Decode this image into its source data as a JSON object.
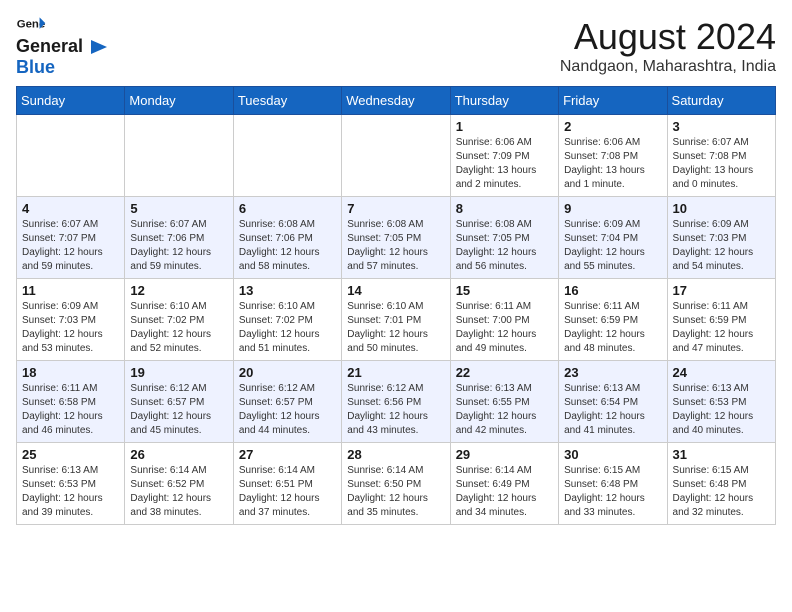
{
  "header": {
    "logo_general": "General",
    "logo_blue": "Blue",
    "month_title": "August 2024",
    "location": "Nandgaon, Maharashtra, India"
  },
  "days_of_week": [
    "Sunday",
    "Monday",
    "Tuesday",
    "Wednesday",
    "Thursday",
    "Friday",
    "Saturday"
  ],
  "weeks": [
    [
      {
        "day": "",
        "info": ""
      },
      {
        "day": "",
        "info": ""
      },
      {
        "day": "",
        "info": ""
      },
      {
        "day": "",
        "info": ""
      },
      {
        "day": "1",
        "info": "Sunrise: 6:06 AM\nSunset: 7:09 PM\nDaylight: 13 hours\nand 2 minutes."
      },
      {
        "day": "2",
        "info": "Sunrise: 6:06 AM\nSunset: 7:08 PM\nDaylight: 13 hours\nand 1 minute."
      },
      {
        "day": "3",
        "info": "Sunrise: 6:07 AM\nSunset: 7:08 PM\nDaylight: 13 hours\nand 0 minutes."
      }
    ],
    [
      {
        "day": "4",
        "info": "Sunrise: 6:07 AM\nSunset: 7:07 PM\nDaylight: 12 hours\nand 59 minutes."
      },
      {
        "day": "5",
        "info": "Sunrise: 6:07 AM\nSunset: 7:06 PM\nDaylight: 12 hours\nand 59 minutes."
      },
      {
        "day": "6",
        "info": "Sunrise: 6:08 AM\nSunset: 7:06 PM\nDaylight: 12 hours\nand 58 minutes."
      },
      {
        "day": "7",
        "info": "Sunrise: 6:08 AM\nSunset: 7:05 PM\nDaylight: 12 hours\nand 57 minutes."
      },
      {
        "day": "8",
        "info": "Sunrise: 6:08 AM\nSunset: 7:05 PM\nDaylight: 12 hours\nand 56 minutes."
      },
      {
        "day": "9",
        "info": "Sunrise: 6:09 AM\nSunset: 7:04 PM\nDaylight: 12 hours\nand 55 minutes."
      },
      {
        "day": "10",
        "info": "Sunrise: 6:09 AM\nSunset: 7:03 PM\nDaylight: 12 hours\nand 54 minutes."
      }
    ],
    [
      {
        "day": "11",
        "info": "Sunrise: 6:09 AM\nSunset: 7:03 PM\nDaylight: 12 hours\nand 53 minutes."
      },
      {
        "day": "12",
        "info": "Sunrise: 6:10 AM\nSunset: 7:02 PM\nDaylight: 12 hours\nand 52 minutes."
      },
      {
        "day": "13",
        "info": "Sunrise: 6:10 AM\nSunset: 7:02 PM\nDaylight: 12 hours\nand 51 minutes."
      },
      {
        "day": "14",
        "info": "Sunrise: 6:10 AM\nSunset: 7:01 PM\nDaylight: 12 hours\nand 50 minutes."
      },
      {
        "day": "15",
        "info": "Sunrise: 6:11 AM\nSunset: 7:00 PM\nDaylight: 12 hours\nand 49 minutes."
      },
      {
        "day": "16",
        "info": "Sunrise: 6:11 AM\nSunset: 6:59 PM\nDaylight: 12 hours\nand 48 minutes."
      },
      {
        "day": "17",
        "info": "Sunrise: 6:11 AM\nSunset: 6:59 PM\nDaylight: 12 hours\nand 47 minutes."
      }
    ],
    [
      {
        "day": "18",
        "info": "Sunrise: 6:11 AM\nSunset: 6:58 PM\nDaylight: 12 hours\nand 46 minutes."
      },
      {
        "day": "19",
        "info": "Sunrise: 6:12 AM\nSunset: 6:57 PM\nDaylight: 12 hours\nand 45 minutes."
      },
      {
        "day": "20",
        "info": "Sunrise: 6:12 AM\nSunset: 6:57 PM\nDaylight: 12 hours\nand 44 minutes."
      },
      {
        "day": "21",
        "info": "Sunrise: 6:12 AM\nSunset: 6:56 PM\nDaylight: 12 hours\nand 43 minutes."
      },
      {
        "day": "22",
        "info": "Sunrise: 6:13 AM\nSunset: 6:55 PM\nDaylight: 12 hours\nand 42 minutes."
      },
      {
        "day": "23",
        "info": "Sunrise: 6:13 AM\nSunset: 6:54 PM\nDaylight: 12 hours\nand 41 minutes."
      },
      {
        "day": "24",
        "info": "Sunrise: 6:13 AM\nSunset: 6:53 PM\nDaylight: 12 hours\nand 40 minutes."
      }
    ],
    [
      {
        "day": "25",
        "info": "Sunrise: 6:13 AM\nSunset: 6:53 PM\nDaylight: 12 hours\nand 39 minutes."
      },
      {
        "day": "26",
        "info": "Sunrise: 6:14 AM\nSunset: 6:52 PM\nDaylight: 12 hours\nand 38 minutes."
      },
      {
        "day": "27",
        "info": "Sunrise: 6:14 AM\nSunset: 6:51 PM\nDaylight: 12 hours\nand 37 minutes."
      },
      {
        "day": "28",
        "info": "Sunrise: 6:14 AM\nSunset: 6:50 PM\nDaylight: 12 hours\nand 35 minutes."
      },
      {
        "day": "29",
        "info": "Sunrise: 6:14 AM\nSunset: 6:49 PM\nDaylight: 12 hours\nand 34 minutes."
      },
      {
        "day": "30",
        "info": "Sunrise: 6:15 AM\nSunset: 6:48 PM\nDaylight: 12 hours\nand 33 minutes."
      },
      {
        "day": "31",
        "info": "Sunrise: 6:15 AM\nSunset: 6:48 PM\nDaylight: 12 hours\nand 32 minutes."
      }
    ]
  ]
}
